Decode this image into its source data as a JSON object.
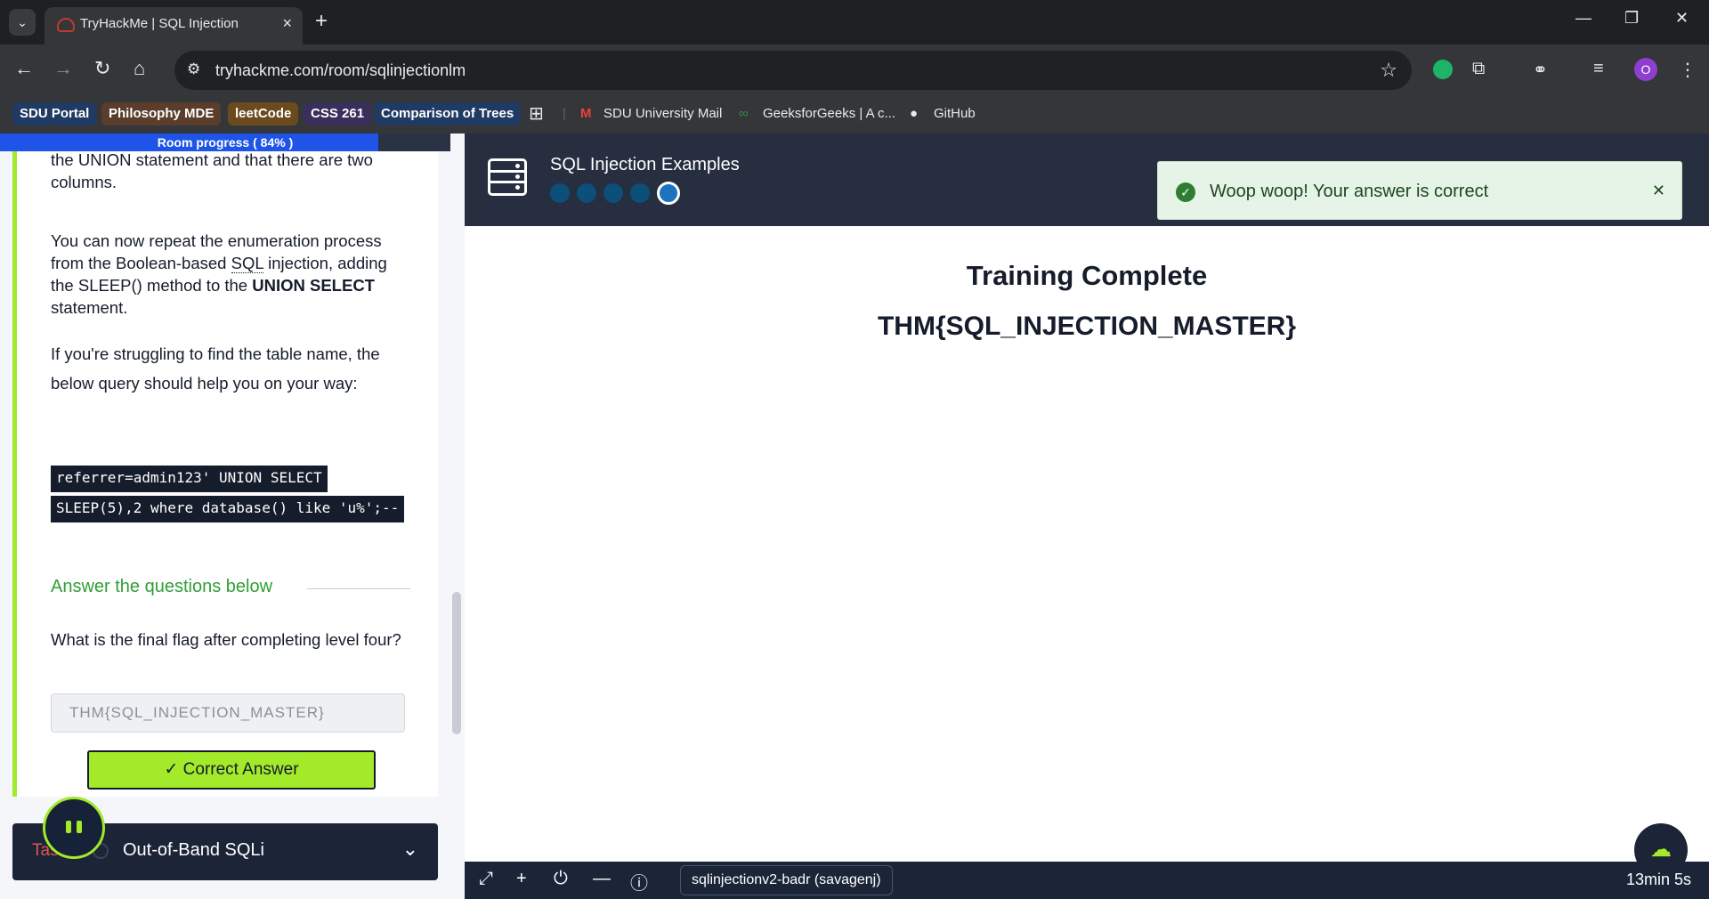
{
  "browser": {
    "tab_title": "TryHackMe | SQL Injection",
    "url": "tryhackme.com/room/sqlinjectionlm",
    "bookmarks": [
      {
        "label": "SDU Portal",
        "color": "#1f3a63"
      },
      {
        "label": "Philosophy MDE",
        "color": "#5a3d2b"
      },
      {
        "label": "leetCode",
        "color": "#6b4a1e"
      },
      {
        "label": "CSS 261",
        "color": "#3a2f5a"
      },
      {
        "label": "Comparison of Trees",
        "color": "#1f3a63"
      }
    ],
    "bookmarks_plain": [
      "SDU University Mail",
      "GeeksforGeeks | A c...",
      "GitHub"
    ],
    "avatar_letter": "O"
  },
  "room": {
    "progress_label": "Room progress ( 84% )",
    "progress_percent": 84,
    "para1": "the UNION statement and that there are two columns.",
    "para2_a": "You can now repeat the enumeration process from the Boolean-based ",
    "para2_sql": "SQL",
    "para2_b": " injection, adding the SLEEP() method to the ",
    "para2_bold": "UNION SELECT",
    "para2_c": " statement.",
    "para3": "If you're struggling to find the table name, the below query should help you on your way:",
    "code_line1": "referrer=admin123' UNION SELECT",
    "code_line2": "SLEEP(5),2 where database() like 'u%';--",
    "answers_heading": "Answer the questions below",
    "question": "What is the final flag after completing level four?",
    "answer_value": "THM{SQL_INJECTION_MASTER}",
    "correct_button": "Correct Answer",
    "next_task_label": "Task",
    "next_task_name": "Out-of-Band SQLi"
  },
  "app": {
    "title": "SQL Injection Examples",
    "level_dots": 5,
    "active_level": 5,
    "toast_message": "Woop woop! Your answer is correct",
    "content_title": "Training Complete",
    "content_flag": "THM{SQL_INJECTION_MASTER}"
  },
  "machine": {
    "name": "sqlinjectionv2-badr (savagenj)",
    "timer": "13min 5s"
  }
}
